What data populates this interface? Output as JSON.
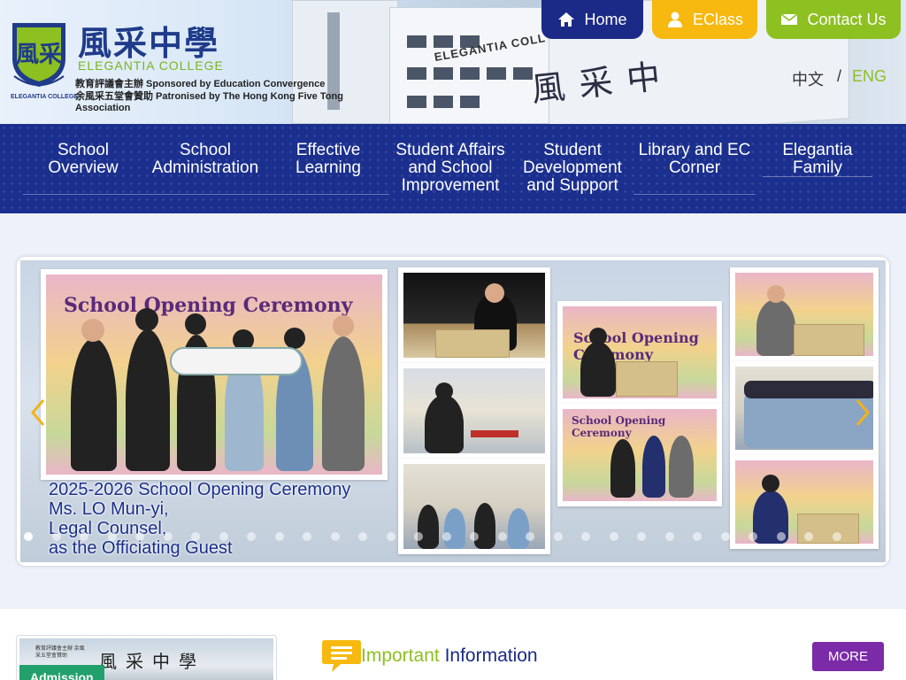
{
  "header": {
    "logo_cn": "風采中學",
    "logo_en": "ELEGANTIA COLLEGE",
    "sponsor_line": "教育評議會主辦 Sponsored by Education Convergence",
    "patron_line": "余風采五堂會贊助 Patronised by The Hong Kong Five Tong Association",
    "crest_label": "ELEGANTIA COLLEGE",
    "building_sign_cn": "風采中",
    "building_sign_en": "ELEGANTIA COLL"
  },
  "top_buttons": {
    "home": "Home",
    "eclass": "EClass",
    "contact": "Contact Us"
  },
  "language": {
    "zh": "中文",
    "separator": "/",
    "en": "ENG"
  },
  "nav": {
    "items": [
      {
        "line1": "School",
        "line2": "Overview",
        "line3": ""
      },
      {
        "line1": "School",
        "line2": "Administration",
        "line3": ""
      },
      {
        "line1": "Effective",
        "line2": "Learning",
        "line3": ""
      },
      {
        "line1": "Student Affairs",
        "line2": "and School",
        "line3": "Improvement"
      },
      {
        "line1": "Student",
        "line2": "Development",
        "line3": "and Support"
      },
      {
        "line1": "Library and EC",
        "line2": "Corner",
        "line3": ""
      },
      {
        "line1": "Elegantia Family",
        "line2": "",
        "line3": ""
      }
    ]
  },
  "carousel": {
    "caption_lines": [
      "2025-2026 School Opening Ceremony",
      "Ms. LO Mun-yi,",
      "Legal Counsel,",
      "as the Officiating Guest"
    ],
    "photo_banner_text": "School Opening Ceremony",
    "dot_count": 30,
    "active_dot": 0
  },
  "admission": {
    "label": "Admission",
    "sign_cn": "風采中學",
    "sign_small": "教育評議會主辦 余風采五堂會贊助"
  },
  "info": {
    "title_part1": "Important",
    "title_part2": "Information",
    "more": "MORE"
  },
  "colors": {
    "navy": "#1b2a86",
    "nav_bg": "#1b2f8e",
    "yellow": "#f7b80f",
    "green": "#8dc021",
    "purple": "#7b2aa8",
    "admission_green": "#22a06b"
  }
}
